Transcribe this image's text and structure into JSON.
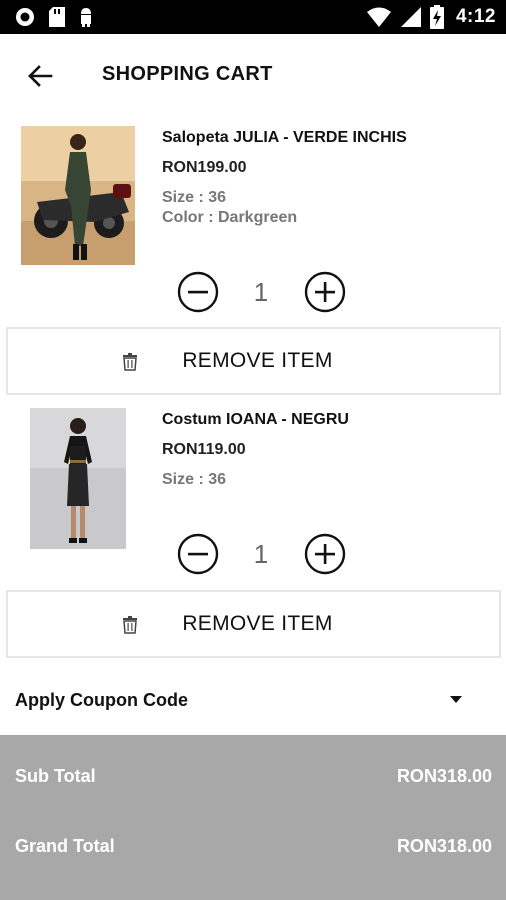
{
  "status_bar": {
    "time": "4:12",
    "left_icons": [
      "notification-ring-icon",
      "sd-card-icon",
      "android-icon"
    ],
    "right_icons": [
      "wifi-icon",
      "cell-signal-icon",
      "battery-charging-icon"
    ]
  },
  "header": {
    "title": "SHOPPING CART",
    "back_icon": "back-arrow-icon"
  },
  "cart": {
    "items": [
      {
        "name": "Salopeta JULIA - VERDE INCHIS",
        "price": "RON199.00",
        "size": "Size : 36",
        "color": "Color : Darkgreen",
        "quantity": "1",
        "remove_label": "REMOVE ITEM"
      },
      {
        "name": "Costum IOANA  - NEGRU",
        "price": "RON119.00",
        "size": "Size : 36",
        "quantity": "1",
        "remove_label": "REMOVE ITEM"
      }
    ]
  },
  "coupon": {
    "label": "Apply Coupon Code"
  },
  "totals": {
    "sub_total_label": "Sub Total",
    "sub_total_value": "RON318.00",
    "grand_total_label": "Grand Total",
    "grand_total_value": "RON318.00"
  },
  "colors": {
    "totals_background": "#a8a8a8",
    "status_bar": "#000000",
    "muted_text": "#777777"
  }
}
